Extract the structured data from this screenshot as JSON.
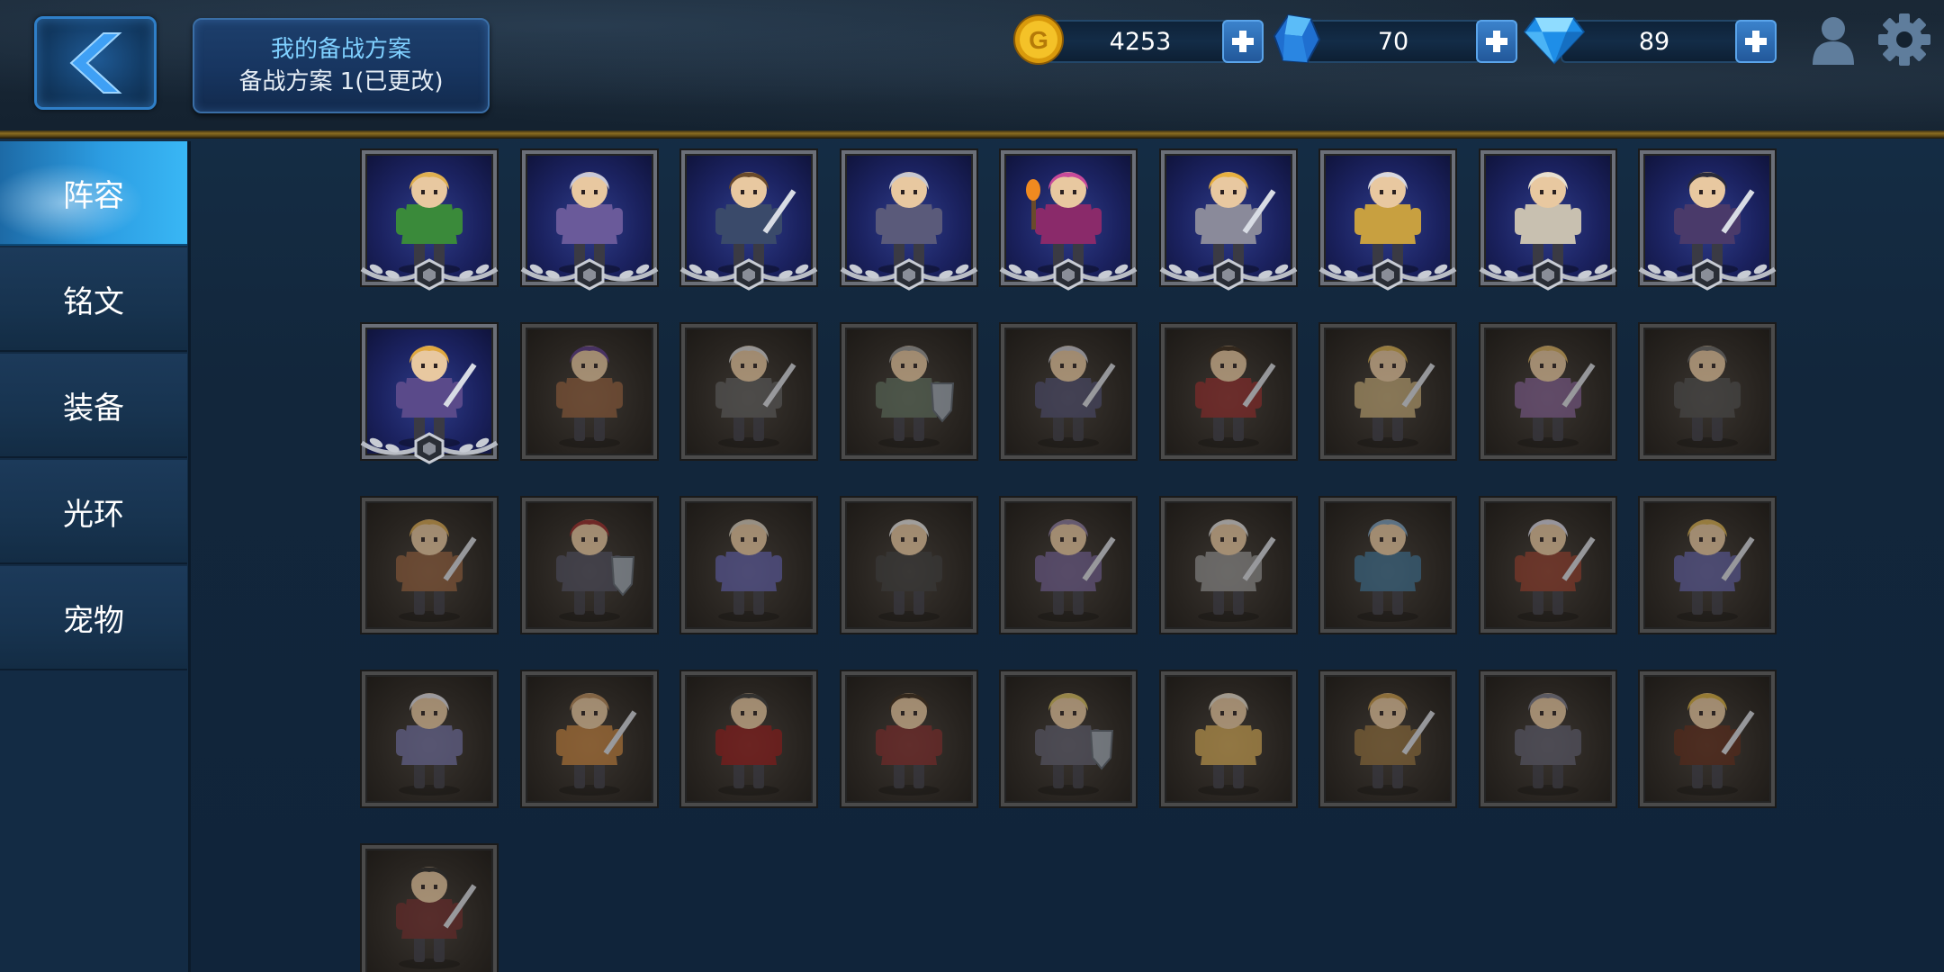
{
  "header": {
    "back_icon": "chevron-left-icon",
    "plan_title": "我的备战方案",
    "plan_subtitle": "备战方案 1(已更改)"
  },
  "currencies": [
    {
      "name": "gold",
      "icon": "gold-coin-icon",
      "value": "4253",
      "color": "#f2b81c"
    },
    {
      "name": "crystal",
      "icon": "blue-crystal-icon",
      "value": "70",
      "color": "#2f8fe6"
    },
    {
      "name": "diamond",
      "icon": "diamond-icon",
      "value": "89",
      "color": "#2aa6f2"
    }
  ],
  "sidebar": {
    "items": [
      {
        "label": "阵容",
        "active": true
      },
      {
        "label": "铭文",
        "active": false
      },
      {
        "label": "装备",
        "active": false
      },
      {
        "label": "光环",
        "active": false
      },
      {
        "label": "宠物",
        "active": false
      }
    ]
  },
  "heroes": [
    {
      "owned": true,
      "accent": "#3a8a3a",
      "hair": "#e0b050",
      "weapon": "none"
    },
    {
      "owned": true,
      "accent": "#6a5a9a",
      "hair": "#c8c8d8",
      "weapon": "none"
    },
    {
      "owned": true,
      "accent": "#3a4a6a",
      "hair": "#6a4a2a",
      "weapon": "sword"
    },
    {
      "owned": true,
      "accent": "#5a5a7a",
      "hair": "#c8c8d0",
      "weapon": "none"
    },
    {
      "owned": true,
      "accent": "#8a2a6a",
      "hair": "#c84a9a",
      "weapon": "torch"
    },
    {
      "owned": true,
      "accent": "#8a8a9a",
      "hair": "#e8b040",
      "weapon": "sword"
    },
    {
      "owned": true,
      "accent": "#c8a040",
      "hair": "#d8d8e0",
      "weapon": "none"
    },
    {
      "owned": true,
      "accent": "#c8c0b0",
      "hair": "#e8e0d0",
      "weapon": "none"
    },
    {
      "owned": true,
      "accent": "#4a3a6a",
      "hair": "#2a2a3a",
      "weapon": "sword"
    },
    {
      "owned": true,
      "accent": "#5a4a8a",
      "hair": "#e0a840",
      "weapon": "sword"
    },
    {
      "owned": false,
      "accent": "#8a5a3a",
      "hair": "#5a3a8a",
      "weapon": "none"
    },
    {
      "owned": false,
      "accent": "#5a5a5a",
      "hair": "#d8d8d8",
      "weapon": "sword"
    },
    {
      "owned": false,
      "accent": "#5a6a5a",
      "hair": "#9a9a9a",
      "weapon": "shield"
    },
    {
      "owned": false,
      "accent": "#4a4a6a",
      "hair": "#c8c8d0",
      "weapon": "sword"
    },
    {
      "owned": false,
      "accent": "#8a2a2a",
      "hair": "#3a2a1a",
      "weapon": "sword"
    },
    {
      "owned": false,
      "accent": "#b8a070",
      "hair": "#d8b050",
      "weapon": "sword"
    },
    {
      "owned": false,
      "accent": "#7a5a8a",
      "hair": "#d8b060",
      "weapon": "sword"
    },
    {
      "owned": false,
      "accent": "#4a4a4a",
      "hair": "#6a6a6a",
      "weapon": "none"
    },
    {
      "owned": false,
      "accent": "#8a5a3a",
      "hair": "#d8a850",
      "weapon": "sword"
    },
    {
      "owned": false,
      "accent": "#4a4a5a",
      "hair": "#9a2a2a",
      "weapon": "shield"
    },
    {
      "owned": false,
      "accent": "#5a5aa0",
      "hair": "#d8d0c0",
      "weapon": "none"
    },
    {
      "owned": false,
      "accent": "#3a3a3a",
      "hair": "#e8e8e8",
      "weapon": "none"
    },
    {
      "owned": false,
      "accent": "#6a5a8a",
      "hair": "#8a7aa0",
      "weapon": "sword"
    },
    {
      "owned": false,
      "accent": "#8a8a8a",
      "hair": "#e0e0e0",
      "weapon": "sword"
    },
    {
      "owned": false,
      "accent": "#3a6a8a",
      "hair": "#7aa0c0",
      "weapon": "none"
    },
    {
      "owned": false,
      "accent": "#8a3a2a",
      "hair": "#d8d8e8",
      "weapon": "sword"
    },
    {
      "owned": false,
      "accent": "#5a5a9a",
      "hair": "#d8b050",
      "weapon": "sword"
    },
    {
      "owned": false,
      "accent": "#6a6a9a",
      "hair": "#e0e0e8",
      "weapon": "none"
    },
    {
      "owned": false,
      "accent": "#b87a3a",
      "hair": "#b88a5a",
      "weapon": "sword"
    },
    {
      "owned": false,
      "accent": "#8a1a1a",
      "hair": "#3a3a3a",
      "weapon": "none"
    },
    {
      "owned": false,
      "accent": "#7a2a2a",
      "hair": "#3a2a1a",
      "weapon": "none"
    },
    {
      "owned": false,
      "accent": "#5a5a6a",
      "hair": "#d8c060",
      "weapon": "shield"
    },
    {
      "owned": false,
      "accent": "#c8a050",
      "hair": "#e8e0d0",
      "weapon": "none"
    },
    {
      "owned": false,
      "accent": "#8a6a3a",
      "hair": "#c89a4a",
      "weapon": "sword"
    },
    {
      "owned": false,
      "accent": "#5a5a6a",
      "hair": "#7a7a8a",
      "weapon": "none"
    },
    {
      "owned": false,
      "accent": "#5a2a1a",
      "hair": "#d8b040",
      "weapon": "sword"
    },
    {
      "owned": false,
      "accent": "#6a2a2a",
      "hair": "#2a2a2a",
      "weapon": "sword"
    }
  ]
}
